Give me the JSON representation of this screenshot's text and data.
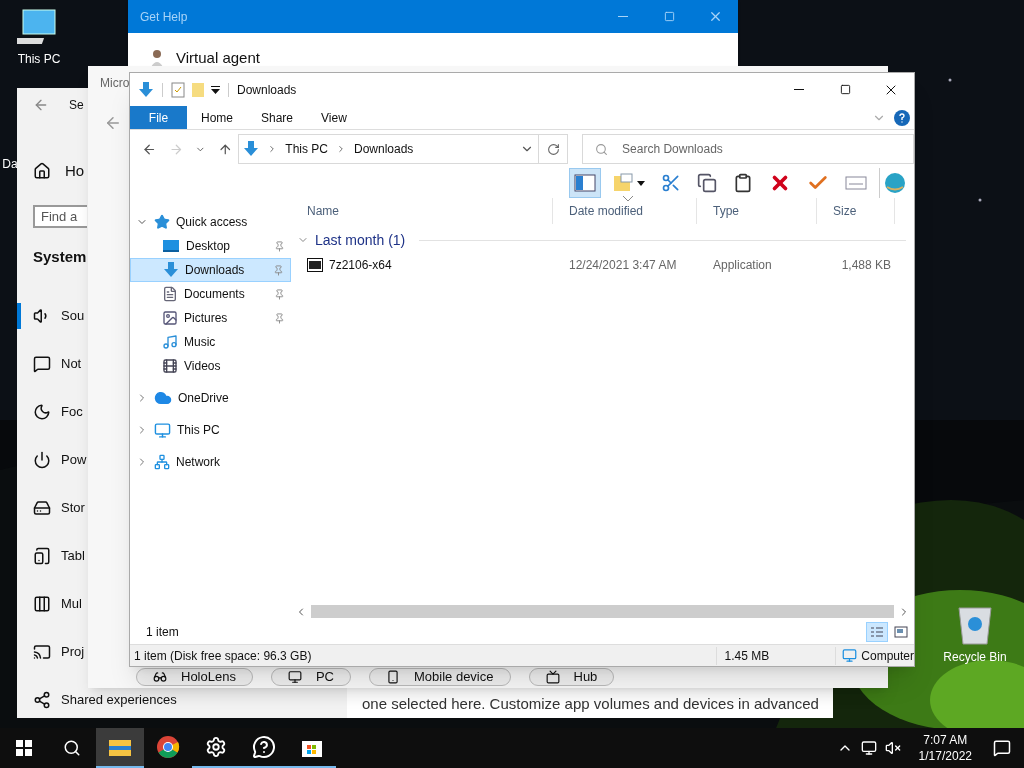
{
  "desktop": {
    "icons": [
      {
        "kind": "pc",
        "label": "This PC"
      },
      {
        "kind": "partial",
        "label": "Da"
      },
      {
        "kind": "bin",
        "label": "Recycle Bin"
      }
    ]
  },
  "get_help": {
    "title": "Get Help",
    "agent": "Virtual agent"
  },
  "settings": {
    "title": "Se",
    "home": "Ho",
    "search_placeholder": "Find a",
    "section": "System",
    "nav": [
      {
        "kind": "sound",
        "label": "Sou",
        "selected": true
      },
      {
        "kind": "notify",
        "label": "Not",
        "selected": false
      },
      {
        "kind": "focus",
        "label": "Foc",
        "selected": false
      },
      {
        "kind": "power",
        "label": "Pow",
        "selected": false
      },
      {
        "kind": "storage",
        "label": "Stor",
        "selected": false
      },
      {
        "kind": "tablet",
        "label": "Tabl",
        "selected": false
      },
      {
        "kind": "multi",
        "label": "Mul",
        "selected": false
      },
      {
        "kind": "project",
        "label": "Proj",
        "selected": false
      },
      {
        "kind": "shared",
        "label": "Shared experiences",
        "selected": false
      }
    ],
    "body_text": "one selected here. Customize app volumes and devices in advanced"
  },
  "device_window": {
    "title": "Micro",
    "devices": [
      {
        "kind": "hololens",
        "label": "HoloLens"
      },
      {
        "kind": "pc",
        "label": "PC"
      },
      {
        "kind": "phone",
        "label": "Mobile device"
      },
      {
        "kind": "hub",
        "label": "Hub"
      }
    ]
  },
  "explorer": {
    "title": "Downloads",
    "ribbon_tabs": [
      {
        "kind": "file",
        "label": "File"
      },
      {
        "kind": "tab",
        "label": "Home"
      },
      {
        "kind": "tab",
        "label": "Share"
      },
      {
        "kind": "tab",
        "label": "View"
      }
    ],
    "address": [
      "This PC",
      "Downloads"
    ],
    "search_placeholder": "Search Downloads",
    "toolbar": [
      {
        "kind": "preview",
        "active": true
      },
      {
        "kind": "newfolder",
        "active": false
      },
      {
        "kind": "cut",
        "active": false
      },
      {
        "kind": "copy",
        "active": false
      },
      {
        "kind": "paste",
        "active": false
      },
      {
        "kind": "delete",
        "active": false
      },
      {
        "kind": "check",
        "active": false
      },
      {
        "kind": "card",
        "active": false
      },
      {
        "kind": "shell",
        "active": false
      }
    ],
    "tree": [
      {
        "kind": "star",
        "label": "Quick access",
        "expanded": true,
        "selected": false,
        "children": [
          {
            "kind": "desktop",
            "label": "Desktop",
            "pinned": true,
            "selected": false
          },
          {
            "kind": "download",
            "label": "Downloads",
            "pinned": true,
            "selected": true
          },
          {
            "kind": "document",
            "label": "Documents",
            "pinned": true,
            "selected": false
          },
          {
            "kind": "pictures",
            "label": "Pictures",
            "pinned": true,
            "selected": false
          },
          {
            "kind": "music",
            "label": "Music",
            "pinned": false,
            "selected": false
          },
          {
            "kind": "videos",
            "label": "Videos",
            "pinned": false,
            "selected": false
          }
        ]
      },
      {
        "kind": "cloud",
        "label": "OneDrive",
        "expanded": false,
        "selected": false
      },
      {
        "kind": "pc",
        "label": "This PC",
        "expanded": false,
        "selected": false
      },
      {
        "kind": "network",
        "label": "Network",
        "expanded": false,
        "selected": false
      }
    ],
    "columns": [
      {
        "label": "Name",
        "sorted": false
      },
      {
        "label": "Date modified",
        "sorted": true
      },
      {
        "label": "Type",
        "sorted": false
      },
      {
        "label": "Size",
        "sorted": false
      }
    ],
    "groups": [
      {
        "label": "Last month (1)",
        "expanded": true,
        "rows": [
          {
            "kind": "archive",
            "cells": [
              "7z2106-x64",
              "12/24/2021 3:47 AM",
              "Application",
              "1,488 KB"
            ]
          }
        ]
      }
    ],
    "item_count": "1 item",
    "views": [
      {
        "kind": "details",
        "selected": true
      },
      {
        "kind": "tiles",
        "selected": false
      }
    ],
    "status": {
      "info": "1 item (Disk free space: 96.3 GB)",
      "size": "1.45 MB",
      "location": "Computer"
    }
  },
  "taskbar": {
    "apps": [
      {
        "kind": "explorer",
        "open": true,
        "selected": true
      },
      {
        "kind": "chrome",
        "open": false,
        "selected": false
      },
      {
        "kind": "gear",
        "open": true,
        "selected": false
      },
      {
        "kind": "help",
        "open": true,
        "selected": false
      },
      {
        "kind": "store",
        "open": true,
        "selected": false
      }
    ],
    "tray": [
      {
        "kind": "chevron"
      },
      {
        "kind": "network"
      },
      {
        "kind": "muted"
      }
    ],
    "time": "7:07 AM",
    "date": "1/17/2022"
  }
}
